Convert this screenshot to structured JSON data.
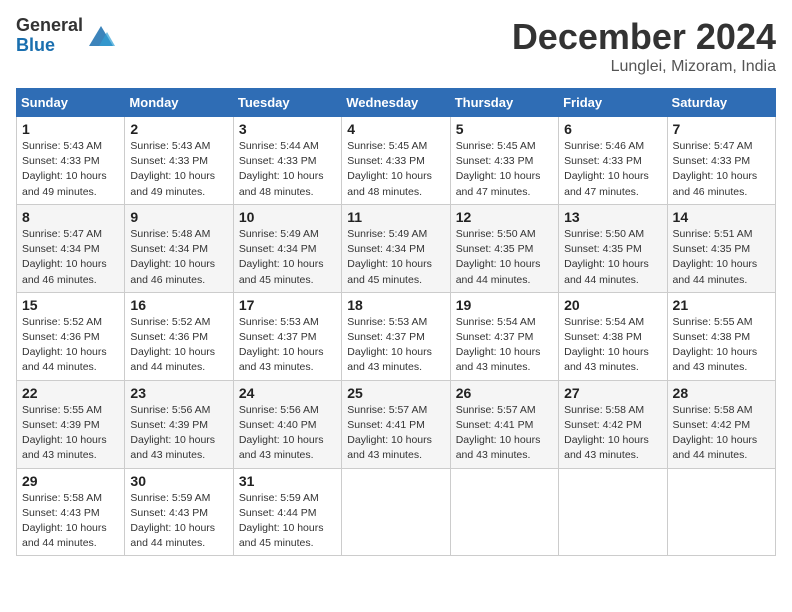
{
  "logo": {
    "general": "General",
    "blue": "Blue"
  },
  "title": "December 2024",
  "location": "Lunglei, Mizoram, India",
  "days_header": [
    "Sunday",
    "Monday",
    "Tuesday",
    "Wednesday",
    "Thursday",
    "Friday",
    "Saturday"
  ],
  "weeks": [
    [
      {
        "day": "1",
        "sunrise": "5:43 AM",
        "sunset": "4:33 PM",
        "daylight": "10 hours and 49 minutes."
      },
      {
        "day": "2",
        "sunrise": "5:43 AM",
        "sunset": "4:33 PM",
        "daylight": "10 hours and 49 minutes."
      },
      {
        "day": "3",
        "sunrise": "5:44 AM",
        "sunset": "4:33 PM",
        "daylight": "10 hours and 48 minutes."
      },
      {
        "day": "4",
        "sunrise": "5:45 AM",
        "sunset": "4:33 PM",
        "daylight": "10 hours and 48 minutes."
      },
      {
        "day": "5",
        "sunrise": "5:45 AM",
        "sunset": "4:33 PM",
        "daylight": "10 hours and 47 minutes."
      },
      {
        "day": "6",
        "sunrise": "5:46 AM",
        "sunset": "4:33 PM",
        "daylight": "10 hours and 47 minutes."
      },
      {
        "day": "7",
        "sunrise": "5:47 AM",
        "sunset": "4:33 PM",
        "daylight": "10 hours and 46 minutes."
      }
    ],
    [
      {
        "day": "8",
        "sunrise": "5:47 AM",
        "sunset": "4:34 PM",
        "daylight": "10 hours and 46 minutes."
      },
      {
        "day": "9",
        "sunrise": "5:48 AM",
        "sunset": "4:34 PM",
        "daylight": "10 hours and 46 minutes."
      },
      {
        "day": "10",
        "sunrise": "5:49 AM",
        "sunset": "4:34 PM",
        "daylight": "10 hours and 45 minutes."
      },
      {
        "day": "11",
        "sunrise": "5:49 AM",
        "sunset": "4:34 PM",
        "daylight": "10 hours and 45 minutes."
      },
      {
        "day": "12",
        "sunrise": "5:50 AM",
        "sunset": "4:35 PM",
        "daylight": "10 hours and 44 minutes."
      },
      {
        "day": "13",
        "sunrise": "5:50 AM",
        "sunset": "4:35 PM",
        "daylight": "10 hours and 44 minutes."
      },
      {
        "day": "14",
        "sunrise": "5:51 AM",
        "sunset": "4:35 PM",
        "daylight": "10 hours and 44 minutes."
      }
    ],
    [
      {
        "day": "15",
        "sunrise": "5:52 AM",
        "sunset": "4:36 PM",
        "daylight": "10 hours and 44 minutes."
      },
      {
        "day": "16",
        "sunrise": "5:52 AM",
        "sunset": "4:36 PM",
        "daylight": "10 hours and 44 minutes."
      },
      {
        "day": "17",
        "sunrise": "5:53 AM",
        "sunset": "4:37 PM",
        "daylight": "10 hours and 43 minutes."
      },
      {
        "day": "18",
        "sunrise": "5:53 AM",
        "sunset": "4:37 PM",
        "daylight": "10 hours and 43 minutes."
      },
      {
        "day": "19",
        "sunrise": "5:54 AM",
        "sunset": "4:37 PM",
        "daylight": "10 hours and 43 minutes."
      },
      {
        "day": "20",
        "sunrise": "5:54 AM",
        "sunset": "4:38 PM",
        "daylight": "10 hours and 43 minutes."
      },
      {
        "day": "21",
        "sunrise": "5:55 AM",
        "sunset": "4:38 PM",
        "daylight": "10 hours and 43 minutes."
      }
    ],
    [
      {
        "day": "22",
        "sunrise": "5:55 AM",
        "sunset": "4:39 PM",
        "daylight": "10 hours and 43 minutes."
      },
      {
        "day": "23",
        "sunrise": "5:56 AM",
        "sunset": "4:39 PM",
        "daylight": "10 hours and 43 minutes."
      },
      {
        "day": "24",
        "sunrise": "5:56 AM",
        "sunset": "4:40 PM",
        "daylight": "10 hours and 43 minutes."
      },
      {
        "day": "25",
        "sunrise": "5:57 AM",
        "sunset": "4:41 PM",
        "daylight": "10 hours and 43 minutes."
      },
      {
        "day": "26",
        "sunrise": "5:57 AM",
        "sunset": "4:41 PM",
        "daylight": "10 hours and 43 minutes."
      },
      {
        "day": "27",
        "sunrise": "5:58 AM",
        "sunset": "4:42 PM",
        "daylight": "10 hours and 43 minutes."
      },
      {
        "day": "28",
        "sunrise": "5:58 AM",
        "sunset": "4:42 PM",
        "daylight": "10 hours and 44 minutes."
      }
    ],
    [
      {
        "day": "29",
        "sunrise": "5:58 AM",
        "sunset": "4:43 PM",
        "daylight": "10 hours and 44 minutes."
      },
      {
        "day": "30",
        "sunrise": "5:59 AM",
        "sunset": "4:43 PM",
        "daylight": "10 hours and 44 minutes."
      },
      {
        "day": "31",
        "sunrise": "5:59 AM",
        "sunset": "4:44 PM",
        "daylight": "10 hours and 45 minutes."
      },
      null,
      null,
      null,
      null
    ]
  ]
}
